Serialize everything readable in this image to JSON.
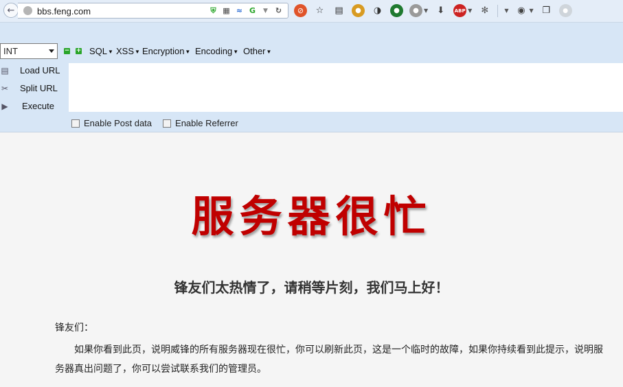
{
  "browser": {
    "url": "bbs.feng.com",
    "colors": {
      "accent": "#c00000",
      "toolbar_bg": "#e4edf8",
      "hackbar_bg": "#d7e6f6"
    }
  },
  "hackbar": {
    "select_value": "INT",
    "menus": [
      {
        "label": "SQL"
      },
      {
        "label": "XSS"
      },
      {
        "label": "Encryption"
      },
      {
        "label": "Encoding"
      },
      {
        "label": "Other"
      }
    ],
    "actions": {
      "load": "Load URL",
      "split": "Split URL",
      "execute": "Execute"
    },
    "checks": {
      "post": "Enable Post data",
      "referrer": "Enable Referrer"
    }
  },
  "page": {
    "title": "服务器很忙",
    "subtitle": "锋友们太热情了，请稍等片刻，我们马上好！",
    "greeting": "锋友们：",
    "body": "如果你看到此页，说明威锋的所有服务器现在很忙，你可以刷新此页，这是一个临时的故障，如果你持续看到此提示，说明服务器真出问题了，你可以尝试联系我们的管理员。"
  }
}
